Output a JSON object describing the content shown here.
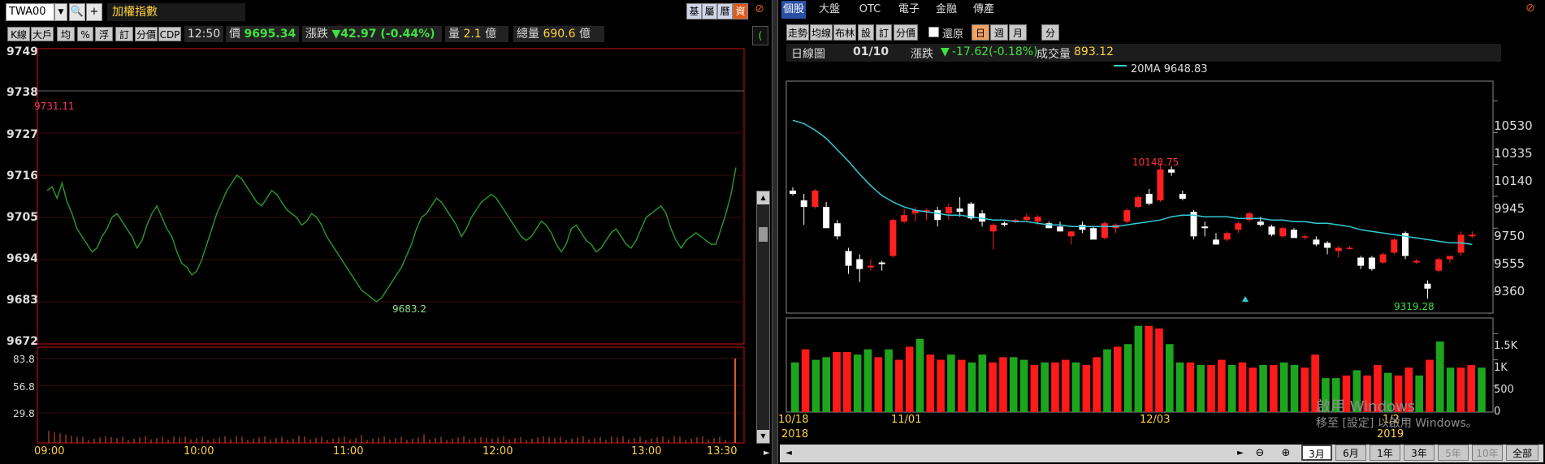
{
  "left": {
    "symbol": "TWA00",
    "index_name": "加權指數",
    "side_buttons": [
      "基",
      "屬",
      "曆",
      "資"
    ],
    "toolbar": [
      "K線",
      "大戶",
      "均",
      "%",
      "浮",
      "訂",
      "分價",
      "CDP"
    ],
    "time": "12:50",
    "price_label": "價",
    "price": "9695.34",
    "change_label": "漲跌",
    "change": "42.97 (-0.44%)",
    "volume_label": "量",
    "volume": "2.1",
    "volume_unit": "億",
    "total_label": "總量",
    "total": "690.6",
    "total_unit": "億",
    "high_label": "9731.11",
    "low_label": "9683.2",
    "y_ticks": [
      "9749",
      "9738",
      "9727",
      "9716",
      "9705",
      "9694",
      "9683",
      "9672"
    ],
    "vol_ticks": [
      "83.8",
      "56.8",
      "29.8"
    ],
    "x_ticks": [
      "09:00",
      "10:00",
      "11:00",
      "12:00",
      "13:00",
      "13:30"
    ]
  },
  "right": {
    "tabs": [
      "個股",
      "大盤",
      "OTC",
      "電子",
      "金融",
      "傳產"
    ],
    "toolbar": [
      "走勢",
      "均線",
      "布林",
      "設",
      "訂",
      "分價"
    ],
    "restore_label": "還原",
    "period_buttons": [
      "日",
      "週",
      "月"
    ],
    "min_button": "分",
    "chart_type": "日線圖",
    "date": "01/10",
    "change_label": "漲跌",
    "change": "-17.62(-0.18%)",
    "volume_label": "成交量",
    "volume": "893.12",
    "ma_legend": "20MA 9648.83",
    "high_label": "10148.75",
    "low_label": "9319.28",
    "y_ticks": [
      "10530",
      "10335",
      "10140",
      "9945",
      "9750",
      "9555",
      "9360"
    ],
    "vol_ticks": [
      "1.5K",
      "1K",
      "500",
      "0"
    ],
    "x_ticks": [
      "10/18",
      "11/01",
      "12/03",
      "1/2"
    ],
    "years": [
      "2018",
      "2019"
    ],
    "range_buttons": [
      "3月",
      "6月",
      "1年",
      "3年",
      "5年",
      "10年",
      "全部"
    ],
    "watermark1": "啟用 Windows",
    "watermark2": "移至 [設定] 以啟用 Windows。"
  },
  "colors": {
    "up": "#ff2020",
    "down": "#ffffff",
    "line": "#2a9a2a",
    "ma": "#33c9d6",
    "vol_up": "#ff1a1a",
    "vol_down": "#1ea51e",
    "intraday_vol": "#d9572a"
  },
  "chart_data": [
    {
      "type": "line",
      "title": "加權指數",
      "x": [
        "09:00",
        "10:00",
        "11:00",
        "12:00",
        "13:00",
        "13:30"
      ],
      "ylim": [
        9672,
        9749
      ],
      "series": [
        {
          "name": "加權指數",
          "values": [
            9712,
            9713,
            9710,
            9714,
            9709,
            9706,
            9702,
            9700,
            9698,
            9696,
            9697,
            9700,
            9702,
            9705,
            9706,
            9704,
            9702,
            9700,
            9697,
            9699,
            9703,
            9706,
            9708,
            9705,
            9702,
            9700,
            9696,
            9693,
            9692,
            9690,
            9691,
            9694,
            9698,
            9702,
            9706,
            9709,
            9712,
            9714,
            9716,
            9715,
            9713,
            9711,
            9709,
            9708,
            9710,
            9712,
            9711,
            9709,
            9707,
            9706,
            9705,
            9703,
            9704,
            9706,
            9705,
            9703,
            9700,
            9698,
            9696,
            9694,
            9692,
            9690,
            9688,
            9686,
            9685,
            9684,
            9683,
            9684,
            9686,
            9688,
            9690,
            9692,
            9695,
            9698,
            9702,
            9705,
            9706,
            9708,
            9710,
            9709,
            9707,
            9705,
            9703,
            9700,
            9702,
            9705,
            9707,
            9709,
            9710,
            9711,
            9710,
            9708,
            9706,
            9704,
            9702,
            9700,
            9699,
            9700,
            9702,
            9704,
            9703,
            9701,
            9698,
            9696,
            9698,
            9702,
            9703,
            9701,
            9699,
            9698,
            9696,
            9697,
            9699,
            9701,
            9702,
            9700,
            9698,
            9697,
            9699,
            9702,
            9705,
            9706,
            9707,
            9708,
            9706,
            9702,
            9699,
            9697,
            9699,
            9700,
            9701,
            9700,
            9699,
            9698,
            9698,
            9702,
            9706,
            9711,
            9718
          ]
        }
      ],
      "volume": {
        "ylim": [
          0,
          95
        ],
        "peak_last": 83.8,
        "ticks": [
          83.8,
          56.8,
          29.8
        ]
      },
      "annotations": [
        "9731.11",
        "9683.2"
      ]
    },
    {
      "type": "candlestick",
      "title": "日線圖",
      "x": [
        "10/18",
        "11/01",
        "12/03",
        "1/2"
      ],
      "ylim": [
        9230,
        10650
      ],
      "candles": [
        {
          "o": 9980,
          "h": 10000,
          "l": 9950,
          "c": 9960
        },
        {
          "o": 9920,
          "h": 9960,
          "l": 9770,
          "c": 9880
        },
        {
          "o": 9880,
          "h": 9990,
          "l": 9870,
          "c": 9980
        },
        {
          "o": 9880,
          "h": 9910,
          "l": 9780,
          "c": 9750
        },
        {
          "o": 9780,
          "h": 9800,
          "l": 9680,
          "c": 9700
        },
        {
          "o": 9610,
          "h": 9630,
          "l": 9470,
          "c": 9520
        },
        {
          "o": 9560,
          "h": 9590,
          "l": 9420,
          "c": 9500
        },
        {
          "o": 9510,
          "h": 9560,
          "l": 9490,
          "c": 9520
        },
        {
          "o": 9540,
          "h": 9550,
          "l": 9490,
          "c": 9530
        },
        {
          "o": 9580,
          "h": 9810,
          "l": 9570,
          "c": 9800
        },
        {
          "o": 9790,
          "h": 9870,
          "l": 9780,
          "c": 9830
        },
        {
          "o": 9840,
          "h": 9880,
          "l": 9790,
          "c": 9860
        },
        {
          "o": 9850,
          "h": 9870,
          "l": 9800,
          "c": 9860
        },
        {
          "o": 9860,
          "h": 9880,
          "l": 9760,
          "c": 9800
        },
        {
          "o": 9840,
          "h": 9900,
          "l": 9800,
          "c": 9880
        },
        {
          "o": 9870,
          "h": 9940,
          "l": 9820,
          "c": 9850
        },
        {
          "o": 9900,
          "h": 9910,
          "l": 9800,
          "c": 9810
        },
        {
          "o": 9840,
          "h": 9860,
          "l": 9760,
          "c": 9790
        },
        {
          "o": 9730,
          "h": 9780,
          "l": 9620,
          "c": 9770
        },
        {
          "o": 9780,
          "h": 9790,
          "l": 9760,
          "c": 9770
        },
        {
          "o": 9790,
          "h": 9810,
          "l": 9780,
          "c": 9800
        },
        {
          "o": 9800,
          "h": 9840,
          "l": 9790,
          "c": 9820
        },
        {
          "o": 9790,
          "h": 9830,
          "l": 9770,
          "c": 9820
        },
        {
          "o": 9780,
          "h": 9790,
          "l": 9750,
          "c": 9750
        },
        {
          "o": 9760,
          "h": 9790,
          "l": 9730,
          "c": 9730
        },
        {
          "o": 9700,
          "h": 9730,
          "l": 9650,
          "c": 9730
        },
        {
          "o": 9770,
          "h": 9790,
          "l": 9720,
          "c": 9740
        },
        {
          "o": 9750,
          "h": 9760,
          "l": 9700,
          "c": 9680
        },
        {
          "o": 9690,
          "h": 9790,
          "l": 9680,
          "c": 9780
        },
        {
          "o": 9750,
          "h": 9780,
          "l": 9720,
          "c": 9770
        },
        {
          "o": 9790,
          "h": 9870,
          "l": 9780,
          "c": 9860
        },
        {
          "o": 9880,
          "h": 9950,
          "l": 9870,
          "c": 9940
        },
        {
          "o": 9960,
          "h": 9990,
          "l": 9890,
          "c": 9900
        },
        {
          "o": 9920,
          "h": 10148.75,
          "l": 9910,
          "c": 10110
        },
        {
          "o": 10110,
          "h": 10130,
          "l": 10070,
          "c": 10090
        },
        {
          "o": 9960,
          "h": 9980,
          "l": 9920,
          "c": 9930
        },
        {
          "o": 9850,
          "h": 9860,
          "l": 9680,
          "c": 9700
        },
        {
          "o": 9760,
          "h": 9790,
          "l": 9700,
          "c": 9750
        },
        {
          "o": 9680,
          "h": 9720,
          "l": 9650,
          "c": 9650
        },
        {
          "o": 9680,
          "h": 9730,
          "l": 9670,
          "c": 9720
        },
        {
          "o": 9740,
          "h": 9790,
          "l": 9720,
          "c": 9780
        },
        {
          "o": 9800,
          "h": 9850,
          "l": 9790,
          "c": 9840
        },
        {
          "o": 9790,
          "h": 9820,
          "l": 9760,
          "c": 9770
        },
        {
          "o": 9760,
          "h": 9770,
          "l": 9700,
          "c": 9710
        },
        {
          "o": 9700,
          "h": 9760,
          "l": 9690,
          "c": 9750
        },
        {
          "o": 9740,
          "h": 9750,
          "l": 9690,
          "c": 9690
        },
        {
          "o": 9700,
          "h": 9710,
          "l": 9680,
          "c": 9700
        },
        {
          "o": 9680,
          "h": 9700,
          "l": 9640,
          "c": 9650
        },
        {
          "o": 9660,
          "h": 9670,
          "l": 9590,
          "c": 9630
        },
        {
          "o": 9610,
          "h": 9640,
          "l": 9570,
          "c": 9630
        },
        {
          "o": 9630,
          "h": 9640,
          "l": 9620,
          "c": 9630
        },
        {
          "o": 9570,
          "h": 9580,
          "l": 9500,
          "c": 9520
        },
        {
          "o": 9570,
          "h": 9580,
          "l": 9490,
          "c": 9500
        },
        {
          "o": 9540,
          "h": 9600,
          "l": 9530,
          "c": 9590
        },
        {
          "o": 9600,
          "h": 9690,
          "l": 9590,
          "c": 9680
        },
        {
          "o": 9720,
          "h": 9730,
          "l": 9560,
          "c": 9580
        },
        {
          "o": 9540,
          "h": 9560,
          "l": 9530,
          "c": 9550
        },
        {
          "o": 9410,
          "h": 9430,
          "l": 9319.28,
          "c": 9380
        },
        {
          "o": 9490,
          "h": 9570,
          "l": 9480,
          "c": 9560
        },
        {
          "o": 9560,
          "h": 9580,
          "l": 9540,
          "c": 9580
        },
        {
          "o": 9600,
          "h": 9730,
          "l": 9580,
          "c": 9710
        },
        {
          "o": 9700,
          "h": 9730,
          "l": 9690,
          "c": 9710
        }
      ],
      "ma20": [
        10410,
        10390,
        10350,
        10300,
        10230,
        10160,
        10080,
        10010,
        9950,
        9910,
        9880,
        9860,
        9850,
        9840,
        9830,
        9830,
        9820,
        9810,
        9800,
        9800,
        9790,
        9790,
        9780,
        9770,
        9770,
        9760,
        9760,
        9760,
        9760,
        9760,
        9770,
        9780,
        9790,
        9800,
        9820,
        9830,
        9830,
        9820,
        9820,
        9820,
        9810,
        9810,
        9810,
        9800,
        9800,
        9790,
        9790,
        9780,
        9780,
        9770,
        9760,
        9740,
        9730,
        9720,
        9710,
        9700,
        9690,
        9680,
        9670,
        9660,
        9660,
        9650
      ],
      "volume": {
        "ylim": [
          0,
          1800
        ],
        "values": [
          950,
          1200,
          1000,
          1050,
          1150,
          1150,
          1100,
          1200,
          1050,
          1200,
          1000,
          1250,
          1400,
          1100,
          1000,
          1100,
          1000,
          950,
          1100,
          950,
          1050,
          1050,
          1000,
          900,
          950,
          950,
          1000,
          950,
          900,
          1050,
          1200,
          1250,
          1300,
          1650,
          1650,
          1600,
          1300,
          950,
          950,
          900,
          900,
          1000,
          900,
          950,
          850,
          900,
          900,
          950,
          900,
          850,
          1100,
          650,
          650,
          700,
          800,
          700,
          900,
          750,
          700,
          850,
          700,
          1000,
          1350,
          850,
          850,
          900,
          850
        ]
      }
    }
  ]
}
